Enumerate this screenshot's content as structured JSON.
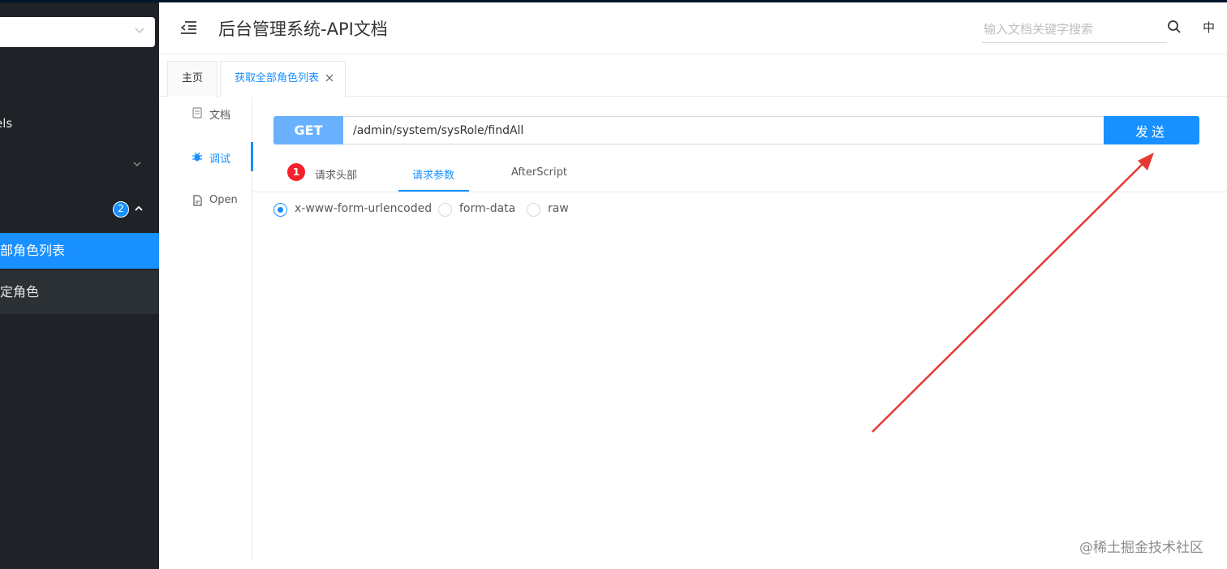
{
  "header": {
    "title": "后台管理系统-API文档",
    "search_placeholder": "输入文档关键字搜索",
    "lang_label": "中"
  },
  "sidebar": {
    "models_label_fragment": "els",
    "group_badge": "2",
    "active_item": "全部角色列表",
    "sub_item": "指定角色"
  },
  "tabs": [
    {
      "label": "主页"
    },
    {
      "label": "获取全部角色列表",
      "active": true
    }
  ],
  "side_nav": {
    "doc": "文档",
    "debug": "调试",
    "open": "Open"
  },
  "request": {
    "method": "GET",
    "url": "/admin/system/sysRole/findAll",
    "send_label": "发送"
  },
  "request_tabs": {
    "headers_badge": "1",
    "headers": "请求头部",
    "params": "请求参数",
    "after_script": "AfterScript"
  },
  "body_types": {
    "options": [
      "x-www-form-urlencoded",
      "form-data",
      "raw"
    ],
    "selected": "x-www-form-urlencoded"
  },
  "watermark": "@稀土掘金技术社区",
  "colors": {
    "primary": "#1890ff",
    "sidebar_bg": "#1f2327",
    "arrow": "#e53935",
    "badge_red": "#f5222d"
  }
}
